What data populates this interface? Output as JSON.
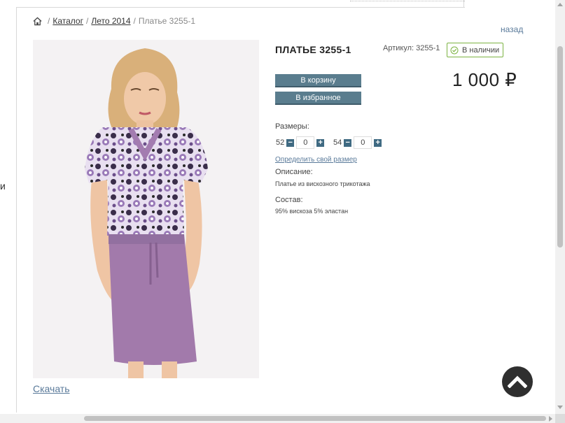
{
  "left_fragment": "и",
  "breadcrumb": {
    "home_icon": "home-icon",
    "catalog": "Каталог",
    "season": "Лето 2014",
    "current": "Платье 3255-1",
    "separator": "/"
  },
  "back_label": "назад",
  "product": {
    "title": "ПЛАТЬЕ 3255-1",
    "article": "Артикул: 3255-1",
    "stock": "В наличии",
    "stock_color": "#7cb342",
    "price": "1 000 ₽",
    "add_to_cart": "В корзину",
    "add_to_favorites": "В избранное",
    "button_color": "#5a7d8e"
  },
  "sizes": {
    "label": "Размеры:",
    "items": [
      {
        "size": "52",
        "qty": "0"
      },
      {
        "size": "54",
        "qty": "0"
      }
    ],
    "define_size": "Определить свой размер"
  },
  "description": {
    "label": "Описание:",
    "text": "Платье из вискозного трикотажа"
  },
  "composition": {
    "label": "Состав:",
    "text": "95% вискоза 5% эластан"
  },
  "download_label": "Скачать",
  "scroll_top_icon": "chevron-up-icon"
}
